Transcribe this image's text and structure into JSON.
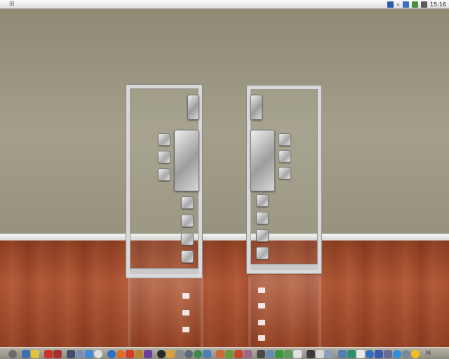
{
  "menubar": {
    "logo_icon": "windows-logo-icon",
    "clock": "15:16",
    "tray_icons": [
      "language-indicator-icon",
      "chevron-left-icon",
      "network-icon",
      "user-icon",
      "volume-icon"
    ]
  },
  "desktop": {
    "left_shelf": {
      "icons": [
        "top-large-icon",
        "small-icon",
        "small-icon",
        "small-icon",
        "center-large-icon",
        "small-icon",
        "small-icon",
        "small-icon",
        "small-icon"
      ]
    },
    "right_shelf": {
      "icons": [
        "top-large-icon",
        "center-large-icon",
        "small-icon",
        "small-icon",
        "small-icon",
        "small-icon",
        "small-icon",
        "small-icon",
        "small-icon"
      ]
    }
  },
  "dock": {
    "label": "M",
    "items_count_groups": [
      {
        "icons": [
          "power-icon",
          "photos-icon",
          "notes-icon",
          "pdf-icon",
          "calendar-icon"
        ]
      },
      {
        "icons": [
          "tools-icon",
          "pencil-icon",
          "finder-icon",
          "clock-icon"
        ]
      },
      {
        "icons": [
          "browser-icon",
          "firefox-icon",
          "mail-icon",
          "bookmark-icon",
          "books-icon"
        ]
      },
      {
        "icons": [
          "settings-icon",
          "network-icon",
          "trash-icon",
          "camera-icon",
          "globe-icon",
          "picture-icon"
        ]
      },
      {
        "icons": [
          "folder-icon",
          "folder-icon",
          "folder-icon",
          "folder-icon"
        ]
      },
      {
        "icons": [
          "chat-icon",
          "chat-icon",
          "download-icon",
          "music-icon",
          "documents-icon"
        ]
      },
      {
        "icons": [
          "bird-icon",
          "print-icon",
          "monitor-icon"
        ]
      },
      {
        "icons": [
          "monitor-icon",
          "screen-icon",
          "doc-icon",
          "globe-icon",
          "people-icon",
          "sharing-icon",
          "app-store-icon",
          "weather-icon",
          "sun-icon"
        ]
      }
    ]
  },
  "colors": {
    "wall": "#a39f8a",
    "floor": "#a84c2b",
    "shelf": "#d9d9d9",
    "dock": "#a39e92"
  }
}
